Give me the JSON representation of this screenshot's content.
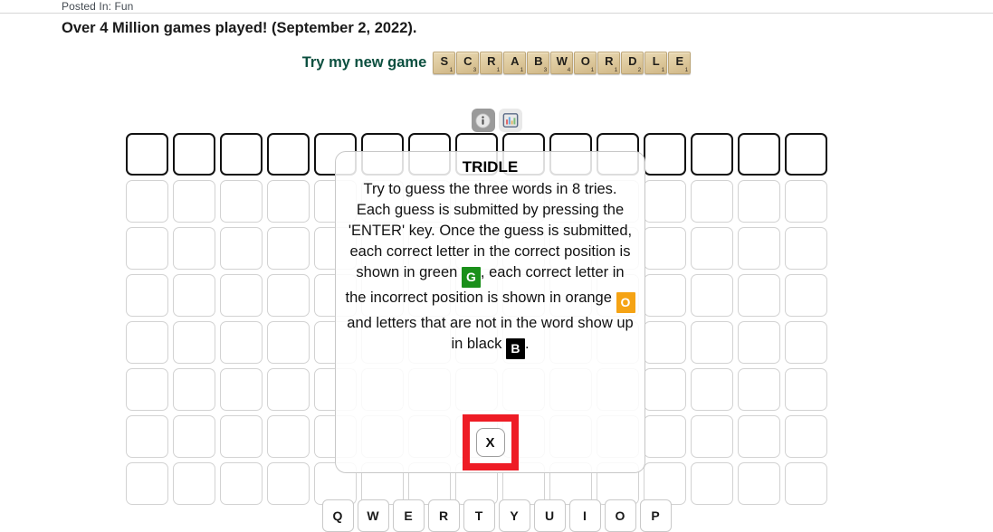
{
  "blog": {
    "posted_in": "Posted In: Fun",
    "headline": "Over 4 Million games played! (September 2, 2022)."
  },
  "promo": {
    "text": "Try my new game",
    "accent_color": "#0b4f3f",
    "tiles": [
      {
        "letter": "S",
        "value": "1"
      },
      {
        "letter": "C",
        "value": "3"
      },
      {
        "letter": "R",
        "value": "1"
      },
      {
        "letter": "A",
        "value": "1"
      },
      {
        "letter": "B",
        "value": "3"
      },
      {
        "letter": "W",
        "value": "4"
      },
      {
        "letter": "O",
        "value": "1"
      },
      {
        "letter": "R",
        "value": "1"
      },
      {
        "letter": "D",
        "value": "2"
      },
      {
        "letter": "L",
        "value": "1"
      },
      {
        "letter": "E",
        "value": "1"
      }
    ]
  },
  "toolbar": {
    "info_label": "info-icon",
    "stats_label": "stats-icon"
  },
  "board": {
    "columns": 15,
    "rows": 8,
    "active_row_index": 0
  },
  "modal": {
    "title": "TRIDLE",
    "para1": "Try to guess the three words in 8 tries.",
    "para2_a": "Each guess is submitted by pressing the 'ENTER' key. Once the guess is submitted, each correct letter in the correct position is shown in green ",
    "green_tile": "G",
    "para2_b": ", each correct letter in the incorrect position is shown in orange ",
    "orange_tile": "O",
    "para2_c": " and letters that are not in the word show up in black ",
    "black_tile": "B",
    "para2_d": ".",
    "close_label": "X",
    "green_color": "#1a8f1a",
    "orange_color": "#f5a314",
    "black_color": "#000000",
    "highlight_color": "#ee1c25"
  },
  "keyboard": {
    "row1": [
      "Q",
      "W",
      "E",
      "R",
      "T",
      "Y",
      "U",
      "I",
      "O",
      "P"
    ]
  }
}
